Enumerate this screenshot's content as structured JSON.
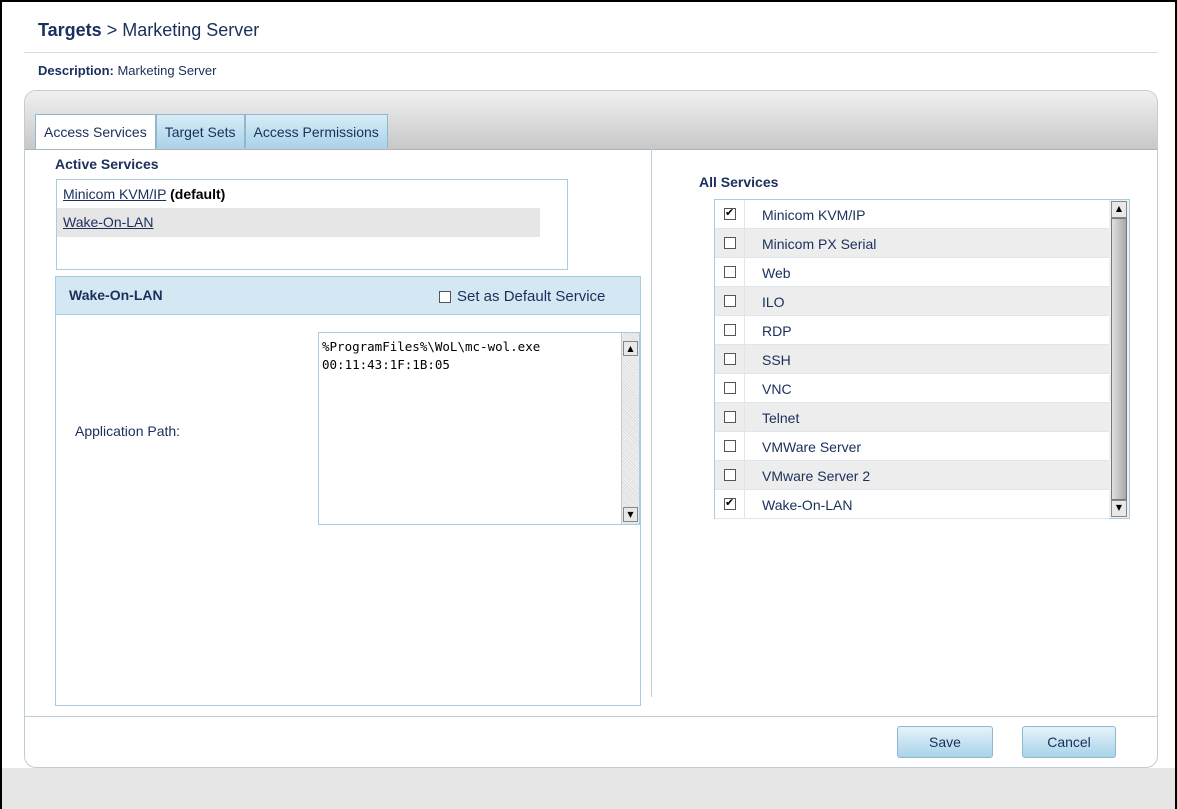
{
  "breadcrumb": {
    "root": "Targets",
    "separator": ">",
    "current": "Marketing Server"
  },
  "description": {
    "label": "Description:",
    "value": "Marketing Server"
  },
  "tabs": [
    {
      "label": "Access Services",
      "active": true
    },
    {
      "label": "Target Sets",
      "active": false
    },
    {
      "label": "Access Permissions",
      "active": false
    }
  ],
  "active_services": {
    "title": "Active Services",
    "items": [
      {
        "name": "Minicom KVM/IP",
        "suffix": "(default)"
      },
      {
        "name": "Wake-On-LAN",
        "suffix": ""
      }
    ]
  },
  "service_detail": {
    "title": "Wake-On-LAN",
    "default_checkbox_label": "Set as Default Service",
    "default_checked": false,
    "app_path_label": "Application Path:",
    "app_path_value": "%ProgramFiles%\\WoL\\mc-wol.exe\n00:11:43:1F:1B:05"
  },
  "all_services": {
    "title": "All Services",
    "items": [
      {
        "name": "Minicom KVM/IP",
        "checked": true
      },
      {
        "name": "Minicom PX Serial",
        "checked": false
      },
      {
        "name": "Web",
        "checked": false
      },
      {
        "name": "ILO",
        "checked": false
      },
      {
        "name": "RDP",
        "checked": false
      },
      {
        "name": "SSH",
        "checked": false
      },
      {
        "name": "VNC",
        "checked": false
      },
      {
        "name": "Telnet",
        "checked": false
      },
      {
        "name": "VMWare Server",
        "checked": false
      },
      {
        "name": "VMware Server 2",
        "checked": false
      },
      {
        "name": "Wake-On-LAN",
        "checked": true
      }
    ]
  },
  "buttons": {
    "save": "Save",
    "cancel": "Cancel"
  },
  "icons": {
    "scroll_up": "scroll-up-arrow-icon",
    "scroll_down": "scroll-down-arrow-icon",
    "checkbox": "checkbox-icon"
  },
  "colors": {
    "accent": "#1a2f5a",
    "tab_fill": "#a9d3ea",
    "border": "#a8cde2"
  }
}
